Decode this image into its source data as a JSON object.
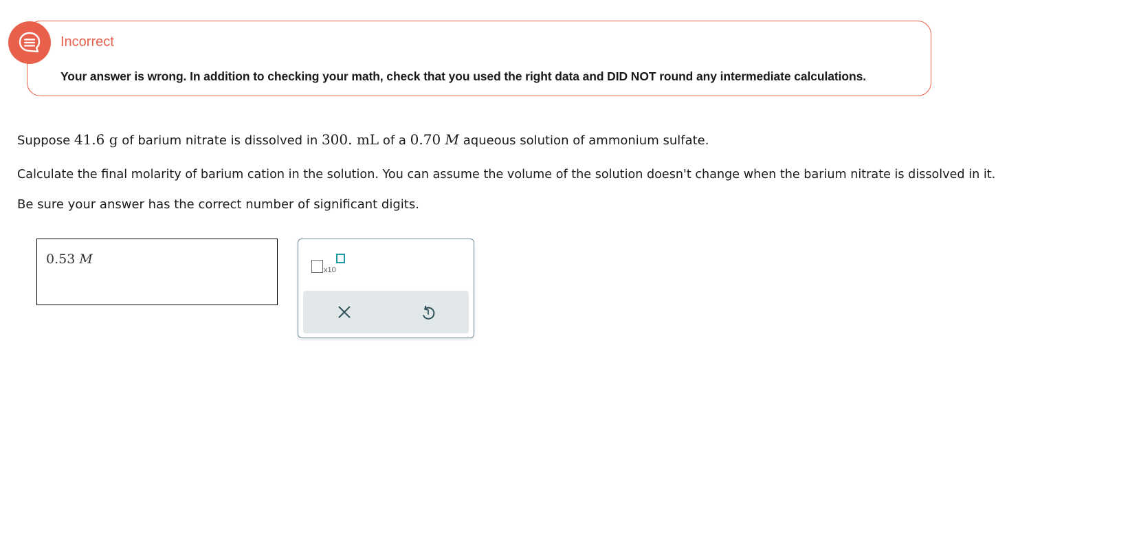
{
  "feedback": {
    "status": "Incorrect",
    "message": "Your answer is wrong. In addition to checking your math, check that you used the right data and DID NOT round any intermediate calculations.",
    "icon": "feedback-chat-icon",
    "color": "#e8604c"
  },
  "question": {
    "line1": {
      "p1": "Suppose ",
      "mass": "41.6",
      "mass_unit": "g",
      "p2": " of barium nitrate is dissolved in ",
      "volume": "300.",
      "volume_unit": "mL",
      "p3": " of a ",
      "conc": "0.70",
      "conc_unit": "M",
      "p4": " aqueous solution of ammonium sulfate."
    },
    "line2": "Calculate the final molarity of barium cation in the solution. You can assume the volume of the solution doesn't change when the barium nitrate is dissolved in it.",
    "line3": "Be sure your answer has the correct number of significant digits."
  },
  "answer": {
    "value": "0.53",
    "unit": "M"
  },
  "palette": {
    "sci_notation_label": "x10",
    "sci_notation_icon": "scientific-notation-icon",
    "clear_icon": "close-icon",
    "undo_icon": "undo-icon",
    "accent": "#1a98a8"
  }
}
